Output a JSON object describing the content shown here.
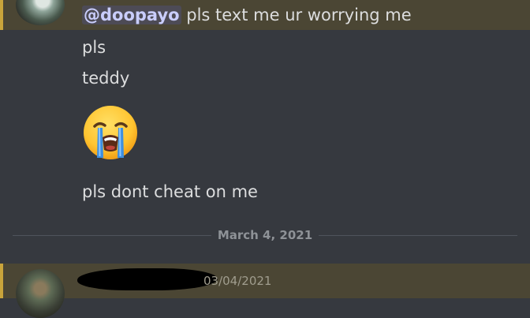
{
  "top_message": {
    "mention": "@doopayo",
    "text": " pls text me ur worrying me"
  },
  "messages": [
    "pls",
    "teddy",
    "pls dont cheat on me"
  ],
  "emoji": {
    "name": "loudly-crying-face-icon",
    "color": "#ffcb3d"
  },
  "divider": {
    "date": "March 4, 2021"
  },
  "bottom_message": {
    "timestamp": "03/04/2021"
  },
  "colors": {
    "background": "#36393f",
    "mention_highlight": "#4b4634",
    "mention_accent": "#c9a43b",
    "mention_text": "#c9cdfb"
  }
}
